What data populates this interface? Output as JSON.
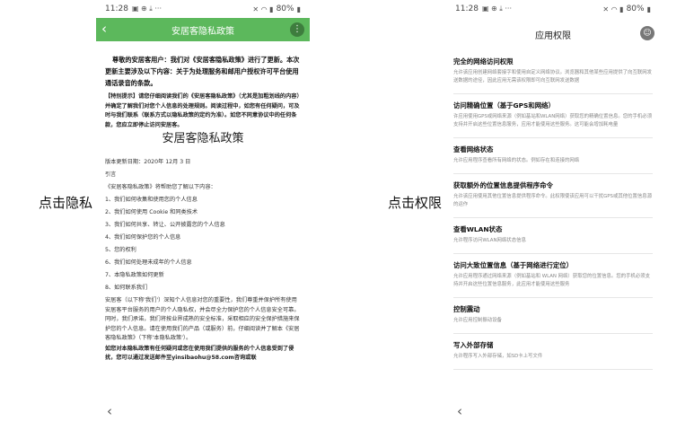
{
  "captions": {
    "left": "点击隐私",
    "right": "点击权限"
  },
  "status": {
    "time": "11:28",
    "battery": "80%"
  },
  "left_screen": {
    "title": "安居客隐私政策",
    "greeting": "尊敬的安居客用户：我们对《安居客隐私政策》进行了更新。本次更新主要涉及以下内容：关于为处理服务和邮用户授权许可平台使用通话录音的条款。",
    "tip": "【特别提示】请您仔细阅读我们的《安居客隐私政策》（尤其是加粗划线的内容）并确定了解我们对您个人信息的处理规则。阅读过程中，如您有任何疑问，可及时与我们联系（联系方式以隐私政策的定约为准）。如您不同意协议中的任何条款，您应立即停止访问安居客。",
    "big_title": "安居客隐私政策",
    "updated": "版本更新日期：2020年 12月 3 日",
    "intro": "引言",
    "help_intro": "《安居客隐私政策》将帮助您了解以下内容：",
    "items": [
      "1、我们如何收集和使用您的个人信息",
      "2、我们如何使用 Cookie 和同类技术",
      "3、我们如何共享、转让、公开披露您的个人信息",
      "4、我们如何保护您的个人信息",
      "5、您的权利",
      "6、我们如何处理未成年的个人信息",
      "7、本隐私政策如何更新",
      "8、如何联系我们"
    ],
    "body": "安居客（以下称'我们'）深知个人信息对您的重要性，我们尊重并保护所有使用安居客平台服务的用户的个人隐私权，并会尽全力保护您的个人信息安全可靠。同时，我们承诺，我们将按业界成熟的安全标准，采取相应的安全保护措施来保护您的个人信息。请在使用我们的产品（或服务）前，仔细阅读并了解本《安居客隐私政策》（下称'本隐私政策'）。",
    "contact": "如您对本隐私政策有任何疑问或您在使用我们提供的服务的个人信息受到了侵扰，您可以通过发送邮件至yinsibaohu@58.com咨询或联"
  },
  "right_screen": {
    "title": "应用权限",
    "permissions": [
      {
        "title": "完全的网络访问权限",
        "desc": "允许该应用创建网络套接字和使用自定义网络协议。浏览器和其他某些应用提供了向互联网发送数据的途径，因此应用无需该权限即可向互联网发送数据"
      },
      {
        "title": "访问精确位置（基于GPS和网络）",
        "desc": "许应用使用GPS或网络来源（例如基站和WLAN网络）获取您的精确位置信息。您的手机必须支持并开启这些位置信息服务，应用才能使用这些服务。这可能会增加耗电量"
      },
      {
        "title": "查看网络状态",
        "desc": "允许应用程序查看所有网络的状态。例如存在和连接的网络"
      },
      {
        "title": "获取额外的位置信息提供程序命令",
        "desc": "允许该应用使用其他位置信息提供程序命令。此权限使该应用可以干扰GPS或其他位置信息源的运作"
      },
      {
        "title": "查看WLAN状态",
        "desc": "允许程序访问WLAN网络状态信息"
      },
      {
        "title": "访问大致位置信息（基于网络进行定位）",
        "desc": "允许应用程序通过网络来源（例如基站和 WLAN 网络）获取您的位置信息。您的手机必须支持并开启这些位置信息服务，此应用才能使用这些服务"
      },
      {
        "title": "控制震动",
        "desc": "允许应用控制振动设备"
      },
      {
        "title": "写入外部存储",
        "desc": "允许程序写入外部存储，如SD卡上写文件"
      }
    ]
  },
  "icons": {
    "back": "chevron-left-icon",
    "more": "more-vert-icon",
    "avatar": "avatar-icon"
  },
  "colors": {
    "appbar_green": "#5cb85c"
  }
}
